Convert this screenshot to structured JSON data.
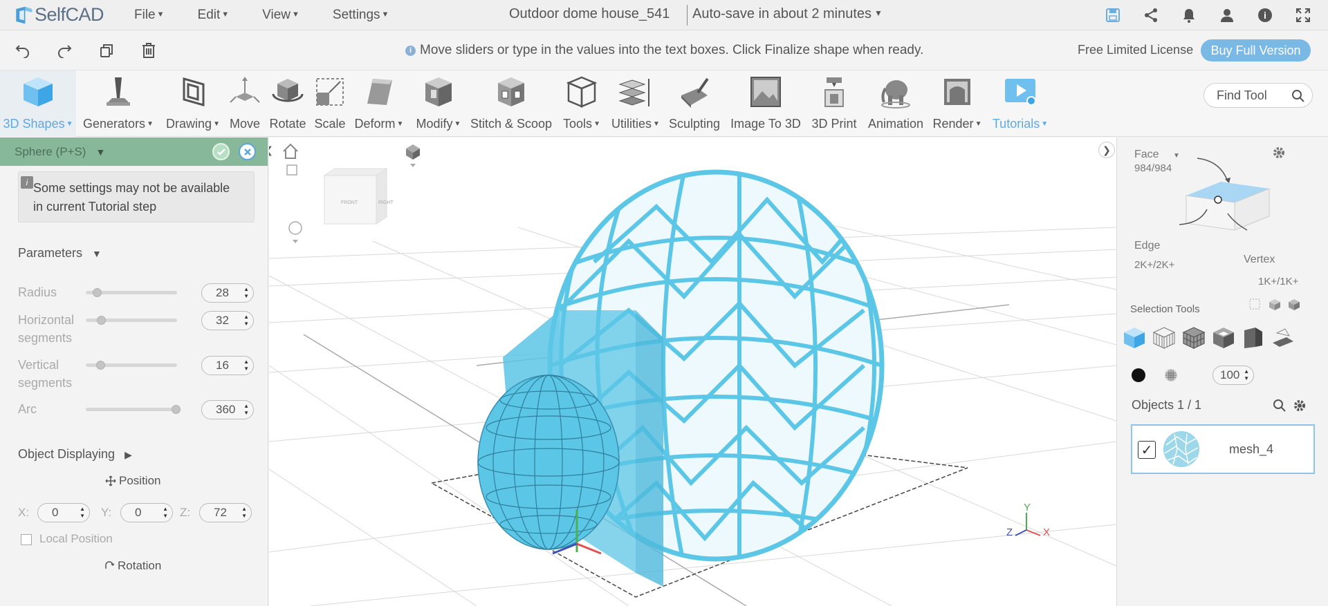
{
  "app": {
    "name": "SelfCAD"
  },
  "menu": [
    "File",
    "Edit",
    "View",
    "Settings"
  ],
  "document": {
    "title": "Outdoor dome house_541",
    "autosave": "Auto-save in about 2 minutes"
  },
  "hint": "Move sliders or type in the values into the text boxes. Click Finalize shape when ready.",
  "license": {
    "label": "Free Limited License",
    "buy": "Buy Full Version"
  },
  "ribbon": {
    "tools": [
      {
        "label": "3D Shapes",
        "dropdown": true
      },
      {
        "label": "Generators",
        "dropdown": true
      },
      {
        "label": "Drawing",
        "dropdown": true
      },
      {
        "label": "Move",
        "dropdown": false
      },
      {
        "label": "Rotate",
        "dropdown": false
      },
      {
        "label": "Scale",
        "dropdown": false
      },
      {
        "label": "Deform",
        "dropdown": true
      },
      {
        "label": "Modify",
        "dropdown": true
      },
      {
        "label": "Stitch & Scoop",
        "dropdown": false
      },
      {
        "label": "Tools",
        "dropdown": true
      },
      {
        "label": "Utilities",
        "dropdown": true
      },
      {
        "label": "Sculpting",
        "dropdown": false
      },
      {
        "label": "Image To 3D",
        "dropdown": false
      },
      {
        "label": "3D Print",
        "dropdown": false
      },
      {
        "label": "Animation",
        "dropdown": false
      },
      {
        "label": "Render",
        "dropdown": true
      },
      {
        "label": "Tutorials",
        "dropdown": true
      }
    ],
    "find_placeholder": "Find Tool"
  },
  "left_panel": {
    "header": "Sphere (P+S)",
    "notice": "Some settings may not be available in current Tutorial step",
    "parameters_title": "Parameters",
    "params": [
      {
        "label": "Radius",
        "value": "28",
        "fraction": 0.12
      },
      {
        "label": "Horizontal segments",
        "value": "32",
        "fraction": 0.16
      },
      {
        "label": "Vertical segments",
        "value": "16",
        "fraction": 0.15
      },
      {
        "label": "Arc",
        "value": "360",
        "fraction": 1.0
      }
    ],
    "object_displaying": "Object Displaying",
    "position_label": "Position",
    "position": {
      "x_label": "X:",
      "x": "0",
      "y_label": "Y:",
      "y": "0",
      "z_label": "Z:",
      "z": "72"
    },
    "local_position": "Local Position",
    "rotation_label": "Rotation"
  },
  "viewport": {
    "cube_front": "FRONT",
    "cube_right": "RIGHT",
    "axis_x": "X",
    "axis_y": "Y",
    "axis_z": "Z"
  },
  "right_panel": {
    "face_label": "Face",
    "face_count": "984/984",
    "edge_label": "Edge",
    "edge_count": "2K+/2K+",
    "vertex_label": "Vertex",
    "vertex_count": "1K+/1K+",
    "selection_tools": "Selection Tools",
    "opacity_value": "100",
    "objects_label": "Objects 1 / 1",
    "object_name": "mesh_4"
  },
  "colors": {
    "accent": "#5ea9e0",
    "panel_header": "#86b899",
    "mesh": "#5cc6e6"
  }
}
